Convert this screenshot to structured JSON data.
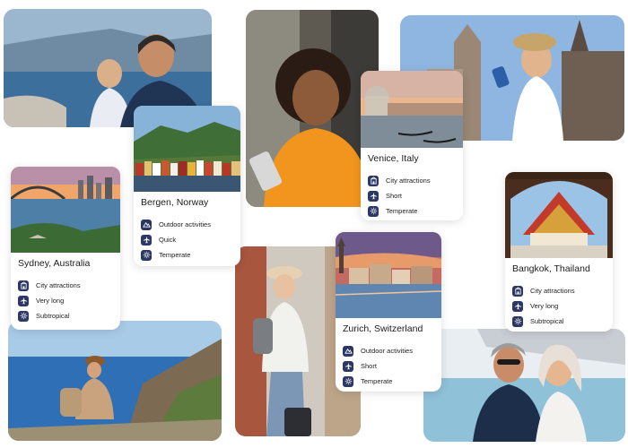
{
  "cards": [
    {
      "id": "bergen",
      "title": "Bergen, Norway",
      "tags": [
        {
          "icon": "mountain-icon",
          "label": "Outdoor activities"
        },
        {
          "icon": "plane-icon",
          "label": "Quick"
        },
        {
          "icon": "sun-icon",
          "label": "Temperate"
        }
      ]
    },
    {
      "id": "venice",
      "title": "Venice, Italy",
      "tags": [
        {
          "icon": "building-icon",
          "label": "City attractions"
        },
        {
          "icon": "plane-icon",
          "label": "Short"
        },
        {
          "icon": "sun-icon",
          "label": "Temperate"
        }
      ]
    },
    {
      "id": "sydney",
      "title": "Sydney, Australia",
      "tags": [
        {
          "icon": "building-icon",
          "label": "City attractions"
        },
        {
          "icon": "plane-icon",
          "label": "Very long"
        },
        {
          "icon": "sun-icon",
          "label": "Subtropical"
        }
      ]
    },
    {
      "id": "zurich",
      "title": "Zurich, Switzerland",
      "tags": [
        {
          "icon": "mountain-icon",
          "label": "Outdoor activities"
        },
        {
          "icon": "plane-icon",
          "label": "Short"
        },
        {
          "icon": "sun-icon",
          "label": "Temperate"
        }
      ]
    },
    {
      "id": "bangkok",
      "title": "Bangkok, Thailand",
      "tags": [
        {
          "icon": "building-icon",
          "label": "City attractions"
        },
        {
          "icon": "plane-icon",
          "label": "Very long"
        },
        {
          "icon": "sun-icon",
          "label": "Subtropical"
        }
      ]
    }
  ],
  "colors": {
    "icon_bg": "#2c3766",
    "card_bg": "#ffffff"
  }
}
